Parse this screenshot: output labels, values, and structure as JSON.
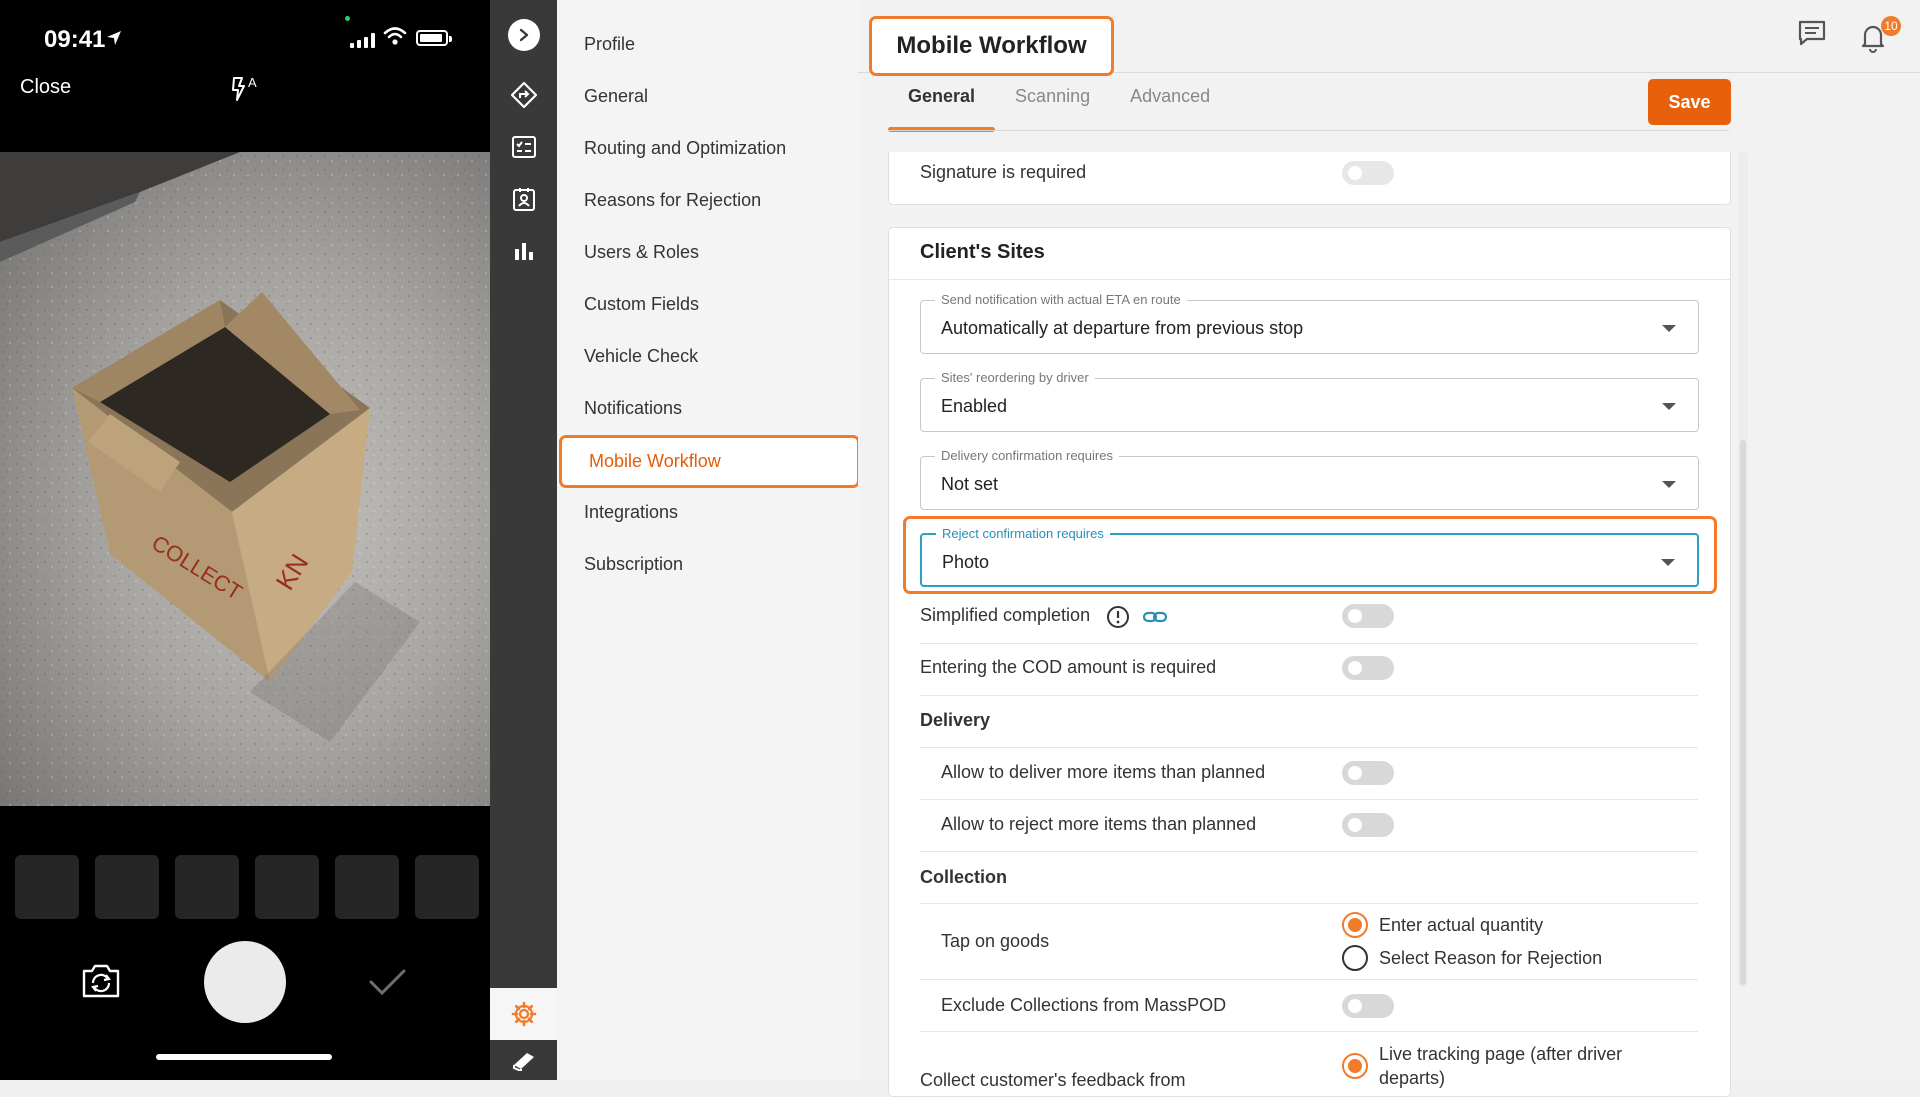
{
  "phone": {
    "time": "09:41",
    "close_label": "Close"
  },
  "settings_nav": {
    "items": [
      "Profile",
      "General",
      "Routing and Optimization",
      "Reasons for Rejection",
      "Users & Roles",
      "Custom Fields",
      "Vehicle Check",
      "Notifications",
      "Mobile Workflow",
      "Integrations",
      "Subscription"
    ],
    "active": "Mobile Workflow"
  },
  "header": {
    "title": "Mobile Workflow",
    "notifications_count": "10"
  },
  "tabs": [
    "General",
    "Scanning",
    "Advanced"
  ],
  "save_label": "Save",
  "signature_row": {
    "label": "Signature is required"
  },
  "clients_sites": {
    "title": "Client's Sites",
    "eta_select": {
      "label": "Send notification with actual ETA en route",
      "value": "Automatically at departure from previous stop"
    },
    "reorder_select": {
      "label": "Sites' reordering by driver",
      "value": "Enabled"
    },
    "delivery_confirm_select": {
      "label": "Delivery confirmation requires",
      "value": "Not set"
    },
    "reject_confirm_select": {
      "label": "Reject confirmation requires",
      "value": "Photo"
    },
    "simplified_completion": "Simplified completion",
    "cod_required": "Entering the COD amount is required",
    "delivery_heading": "Delivery",
    "deliver_more": "Allow to deliver more items than planned",
    "reject_more": "Allow to reject more items than planned",
    "collection_heading": "Collection",
    "tap_on_goods": "Tap on goods",
    "tap_options": [
      "Enter actual quantity",
      "Select Reason for Rejection"
    ],
    "exclude_masspod": "Exclude Collections from MassPOD",
    "feedback_label": "Collect customer's feedback from",
    "feedback_option": "Live tracking page (after driver departs)"
  },
  "colors": {
    "accent": "#f27b2a",
    "save_button": "#e8600b",
    "rail": "#393939",
    "focus_blue": "#2aa0c8"
  }
}
